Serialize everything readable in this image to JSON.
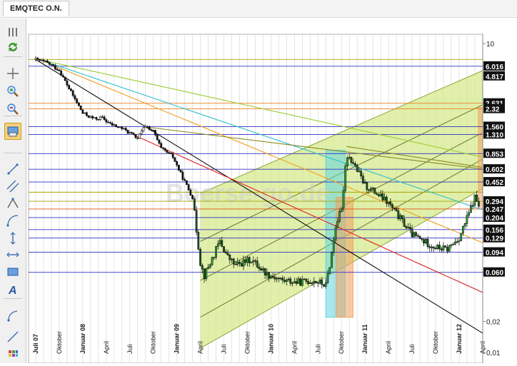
{
  "window": {
    "title": "EMQTEC O.N."
  },
  "toolbar": {
    "tools": [
      {
        "name": "menu-icon"
      },
      {
        "name": "refresh-icon"
      },
      {
        "name": "crosshair-icon"
      },
      {
        "name": "zoom-in-icon"
      },
      {
        "name": "zoom-out-icon"
      },
      {
        "name": "chart-settings-icon",
        "active": true
      },
      {
        "name": "trendline-icon"
      },
      {
        "name": "channel-icon"
      },
      {
        "name": "triangle-icon"
      },
      {
        "name": "fibonacci-icon"
      },
      {
        "name": "vertical-line-icon"
      },
      {
        "name": "horizontal-line-icon"
      },
      {
        "name": "rectangle-icon"
      },
      {
        "name": "text-icon"
      },
      {
        "name": "arc-icon"
      },
      {
        "name": "line-icon"
      },
      {
        "name": "palette-icon"
      }
    ]
  },
  "chart_data": {
    "type": "candlestick",
    "title": "",
    "watermark": "Boerse-go.de",
    "y_scale": "log",
    "ylim": [
      0.01,
      10
    ],
    "y_axis_labels": [
      {
        "value": 10,
        "label": "10",
        "boxed": false
      },
      {
        "value": 6.016,
        "label": "6.016",
        "boxed": true
      },
      {
        "value": 4.817,
        "label": "4.817",
        "boxed": true
      },
      {
        "value": 2.631,
        "label": "2.631",
        "boxed": true
      },
      {
        "value": 2.32,
        "label": "2.32",
        "boxed": true
      },
      {
        "value": 1.56,
        "label": "1.560",
        "boxed": true
      },
      {
        "value": 1.31,
        "label": "1.310",
        "boxed": true
      },
      {
        "value": 0.853,
        "label": "0.853",
        "boxed": true
      },
      {
        "value": 0.602,
        "label": "0.602",
        "boxed": true
      },
      {
        "value": 0.452,
        "label": "0.452",
        "boxed": true
      },
      {
        "value": 0.294,
        "label": "0.294",
        "boxed": true
      },
      {
        "value": 0.247,
        "label": "0.247",
        "boxed": true
      },
      {
        "value": 0.204,
        "label": "0.204",
        "boxed": true
      },
      {
        "value": 0.156,
        "label": "0.156",
        "boxed": true
      },
      {
        "value": 0.129,
        "label": "0.129",
        "boxed": true
      },
      {
        "value": 0.094,
        "label": "0.094",
        "boxed": true
      },
      {
        "value": 0.06,
        "label": "0.060",
        "boxed": true
      },
      {
        "value": 0.02,
        "label": "0,02",
        "boxed": false
      },
      {
        "value": 0.01,
        "label": "0,01",
        "boxed": false
      }
    ],
    "x_labels": [
      {
        "month": "2007-07",
        "label": "Juli 07",
        "bold": true
      },
      {
        "month": "2007-10",
        "label": "Oktober",
        "bold": false
      },
      {
        "month": "2008-01",
        "label": "Januar 08",
        "bold": true
      },
      {
        "month": "2008-04",
        "label": "April",
        "bold": false
      },
      {
        "month": "2008-07",
        "label": "Juli",
        "bold": false
      },
      {
        "month": "2008-10",
        "label": "Oktober",
        "bold": false
      },
      {
        "month": "2009-01",
        "label": "Januar 09",
        "bold": true
      },
      {
        "month": "2009-04",
        "label": "April",
        "bold": false
      },
      {
        "month": "2009-07",
        "label": "Juli",
        "bold": false
      },
      {
        "month": "2009-10",
        "label": "Oktober",
        "bold": false
      },
      {
        "month": "2010-01",
        "label": "Januar 10",
        "bold": true
      },
      {
        "month": "2010-04",
        "label": "April",
        "bold": false
      },
      {
        "month": "2010-07",
        "label": "Juli",
        "bold": false
      },
      {
        "month": "2010-10",
        "label": "Oktober",
        "bold": false
      },
      {
        "month": "2011-01",
        "label": "Januar 11",
        "bold": true
      },
      {
        "month": "2011-04",
        "label": "April",
        "bold": false
      },
      {
        "month": "2011-07",
        "label": "Juli",
        "bold": false
      },
      {
        "month": "2011-10",
        "label": "Oktober",
        "bold": false
      },
      {
        "month": "2012-01",
        "label": "Januar 12",
        "bold": true
      },
      {
        "month": "2012-04",
        "label": "April",
        "bold": false
      }
    ],
    "price_path": [
      [
        "2007-07-01",
        7.0
      ],
      [
        "2007-08-15",
        6.5
      ],
      [
        "2007-10-01",
        5.5
      ],
      [
        "2007-11-15",
        3.4
      ],
      [
        "2008-01-01",
        2.1
      ],
      [
        "2008-02-15",
        1.85
      ],
      [
        "2008-03-15",
        1.9
      ],
      [
        "2008-04-15",
        1.65
      ],
      [
        "2008-06-01",
        1.5
      ],
      [
        "2008-07-01",
        1.35
      ],
      [
        "2008-08-01",
        1.2
      ],
      [
        "2008-09-01",
        1.6
      ],
      [
        "2008-10-01",
        1.4
      ],
      [
        "2008-11-01",
        0.95
      ],
      [
        "2008-12-15",
        0.8
      ],
      [
        "2009-01-15",
        0.55
      ],
      [
        "2009-03-01",
        0.32
      ],
      [
        "2009-04-01",
        0.075
      ],
      [
        "2009-04-15",
        0.055
      ],
      [
        "2009-05-15",
        0.08
      ],
      [
        "2009-06-15",
        0.12
      ],
      [
        "2009-07-15",
        0.085
      ],
      [
        "2009-08-15",
        0.07
      ],
      [
        "2009-10-15",
        0.08
      ],
      [
        "2009-12-15",
        0.058
      ],
      [
        "2010-02-15",
        0.05
      ],
      [
        "2010-04-15",
        0.048
      ],
      [
        "2010-06-15",
        0.05
      ],
      [
        "2010-08-01",
        0.045
      ],
      [
        "2010-08-20",
        0.08
      ],
      [
        "2010-09-10",
        0.18
      ],
      [
        "2010-10-01",
        0.24
      ],
      [
        "2010-10-20",
        0.85
      ],
      [
        "2010-11-15",
        0.7
      ],
      [
        "2011-01-01",
        0.42
      ],
      [
        "2011-02-15",
        0.35
      ],
      [
        "2011-04-01",
        0.28
      ],
      [
        "2011-05-15",
        0.2
      ],
      [
        "2011-07-01",
        0.14
      ],
      [
        "2011-08-15",
        0.12
      ],
      [
        "2011-10-01",
        0.105
      ],
      [
        "2011-11-15",
        0.1
      ],
      [
        "2012-01-01",
        0.13
      ],
      [
        "2012-02-01",
        0.2
      ],
      [
        "2012-03-01",
        0.32
      ],
      [
        "2012-03-20",
        0.26
      ]
    ],
    "horizontal_lines": [
      {
        "value": 7.0,
        "color": "#a5a500"
      },
      {
        "value": 6.016,
        "color": "#3030c0"
      },
      {
        "value": 2.631,
        "color": "#f08020"
      },
      {
        "value": 2.32,
        "color": "#f08020"
      },
      {
        "value": 1.56,
        "color": "#3030c0"
      },
      {
        "value": 1.31,
        "color": "#3030c0"
      },
      {
        "value": 0.853,
        "color": "#3030c0"
      },
      {
        "value": 0.602,
        "color": "#3030c0"
      },
      {
        "value": 0.452,
        "color": "#3030c0"
      },
      {
        "value": 0.36,
        "color": "#a5a500"
      },
      {
        "value": 0.294,
        "color": "#a5a500"
      },
      {
        "value": 0.247,
        "color": "#e05010"
      },
      {
        "value": 0.204,
        "color": "#3030c0"
      },
      {
        "value": 0.156,
        "color": "#3030c0"
      },
      {
        "value": 0.129,
        "color": "#3030c0"
      },
      {
        "value": 0.094,
        "color": "#3030c0"
      },
      {
        "value": 0.06,
        "color": "#3030c0"
      }
    ],
    "trendlines": [
      {
        "color": "#111111",
        "from": [
          "2007-07-01",
          7.0
        ],
        "to": [
          "2012-09-01",
          0.009
        ]
      },
      {
        "color": "#e02020",
        "from": [
          "2008-07-15",
          1.3
        ],
        "to": [
          "2012-11-01",
          0.022
        ]
      },
      {
        "color": "#f0a020",
        "from": [
          "2007-07-15",
          7.0
        ],
        "to": [
          "2012-11-01",
          0.07
        ]
      },
      {
        "color": "#30c0d0",
        "from": [
          "2007-07-15",
          7.0
        ],
        "to": [
          "2012-11-01",
          0.16
        ]
      },
      {
        "color": "#9acd32",
        "from": [
          "2007-07-15",
          7.0
        ],
        "to": [
          "2012-11-01",
          0.6
        ]
      },
      {
        "color": "#8a8a20",
        "from": [
          "2008-09-01",
          1.55
        ],
        "to": [
          "2012-11-01",
          0.52
        ]
      },
      {
        "color": "#8a8a20",
        "from": [
          "2010-10-20",
          1.0
        ],
        "to": [
          "2012-11-01",
          0.52
        ]
      }
    ],
    "channel": {
      "lower": [
        [
          "2009-04-01",
          0.011
        ],
        [
          "2012-11-01",
          0.78
        ]
      ],
      "upper": [
        [
          "2009-04-01",
          0.35
        ],
        [
          "2012-11-01",
          9.3
        ]
      ],
      "inner_lines": [
        [
          [
            "2009-04-01",
            0.022
          ],
          [
            "2012-11-01",
            1.5
          ]
        ],
        [
          [
            "2009-04-01",
            0.05
          ],
          [
            "2012-11-01",
            2.6
          ]
        ],
        [
          [
            "2009-04-01",
            0.12
          ],
          [
            "2012-11-01",
            4.6
          ]
        ]
      ],
      "fill_color": "#d5ea8c",
      "line_color": "#8aa838"
    },
    "zones": [
      {
        "from": "2010-08-01",
        "to": "2010-10-15",
        "low": 0.022,
        "high": 0.92,
        "color": "#62d5e0"
      },
      {
        "from": "2010-09-10",
        "to": "2010-11-15",
        "low": 0.022,
        "high": 0.32,
        "color": "#f0a060"
      },
      {
        "from": "2012-04-01",
        "to": "2012-07-01",
        "low": 0.247,
        "high": 6.5,
        "color": "#62d5e0"
      },
      {
        "from": "2012-03-15",
        "to": "2012-06-01",
        "low": 0.247,
        "high": 2.4,
        "color": "#f0a060"
      }
    ],
    "grid": true,
    "legend": "none"
  }
}
